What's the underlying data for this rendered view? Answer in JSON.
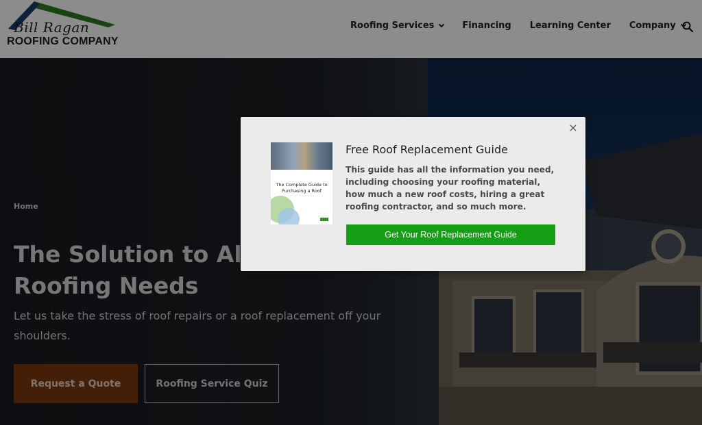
{
  "header": {
    "logo_script": "Bill Ragan",
    "logo_text": "ROOFING COMPANY",
    "nav": [
      {
        "label": "Roofing Services",
        "has_dropdown": true
      },
      {
        "label": "Financing",
        "has_dropdown": false
      },
      {
        "label": "Learning Center",
        "has_dropdown": false
      },
      {
        "label": "Company",
        "has_dropdown": true
      }
    ],
    "search_icon": "search-icon"
  },
  "hero": {
    "breadcrumb": "Home",
    "title_line1": "The Solution to All of",
    "title_line2": "Roofing Needs",
    "subtitle": "Let us take the stress of roof repairs or a roof replacement off your shoulders.",
    "primary_button": "Request a Quote",
    "secondary_button": "Roofing Service Quiz"
  },
  "modal": {
    "close_label": "×",
    "cover_title": "The Complete Guide to Purchasing a Roof",
    "title": "Free Roof Replacement Guide",
    "body": "This guide has all the information you need, including choosing your roofing material, how much a new roof costs, hiring a great roofing contractor, and so much more.",
    "cta": "Get Your Roof Replacement Guide"
  },
  "colors": {
    "cta_green": "#149f14",
    "quote_orange": "#7a3a10",
    "logo_green": "#3b8a2e"
  }
}
